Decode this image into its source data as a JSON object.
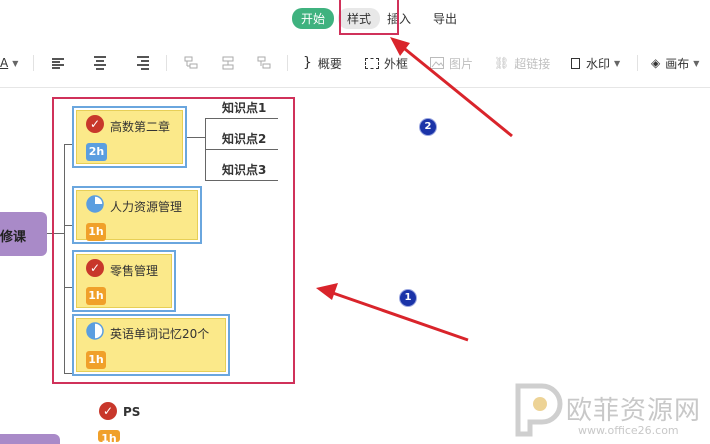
{
  "menu": {
    "tabs": [
      {
        "label": "开始",
        "state": "active"
      },
      {
        "label": "样式",
        "state": "highlighted"
      },
      {
        "label": "插入",
        "state": "normal"
      },
      {
        "label": "导出",
        "state": "normal"
      }
    ],
    "visible_fragments": {
      "insert": "插入"
    }
  },
  "toolbar": {
    "font_color_letter": "A",
    "summary_label": "概要",
    "frame_label": "外框",
    "image_label": "图片",
    "hyperlink_label": "超链接",
    "watermark_label": "水印",
    "canvas_label": "画布",
    "icons": [
      "align-left-icon",
      "align-center-icon",
      "align-right-icon",
      "layout-1-icon",
      "layout-2-icon",
      "layout-3-icon",
      "summary-brace-icon",
      "frame-icon",
      "image-icon",
      "link-icon",
      "watermark-icon",
      "canvas-fill-icon"
    ]
  },
  "mindmap": {
    "root": {
      "label": "必修课",
      "visible_label": "修课"
    },
    "nodes": [
      {
        "label": "高数第二章",
        "status_icon": "check-icon",
        "time": "2h",
        "badge_color": "#5b9ee0"
      },
      {
        "label": "人力资源管理",
        "status_icon": "pie-quarter-icon",
        "time": "1h",
        "badge_color": "#f0a02a"
      },
      {
        "label": "零售管理",
        "status_icon": "check-icon",
        "time": "1h",
        "badge_color": "#f0a02a"
      },
      {
        "label": "英语单词记忆20个",
        "status_icon": "pie-half-icon",
        "time": "1h",
        "badge_color": "#f0a02a"
      }
    ],
    "subtopics": [
      "知识点1",
      "知识点2",
      "知识点3"
    ],
    "extra_node": {
      "label": "PS",
      "time": "1h"
    }
  },
  "annotations": {
    "step_1": "1",
    "step_2": "2",
    "highlight_color": "#d0315a",
    "arrow_color": "#d9242b"
  },
  "watermark": {
    "text": "欧菲资源网",
    "url": "www.office26.com"
  },
  "colors": {
    "accent_green": "#3fb27f",
    "node_fill": "#fbe98a",
    "node_border": "#6aa6de",
    "root_fill": "#a98ac8"
  }
}
